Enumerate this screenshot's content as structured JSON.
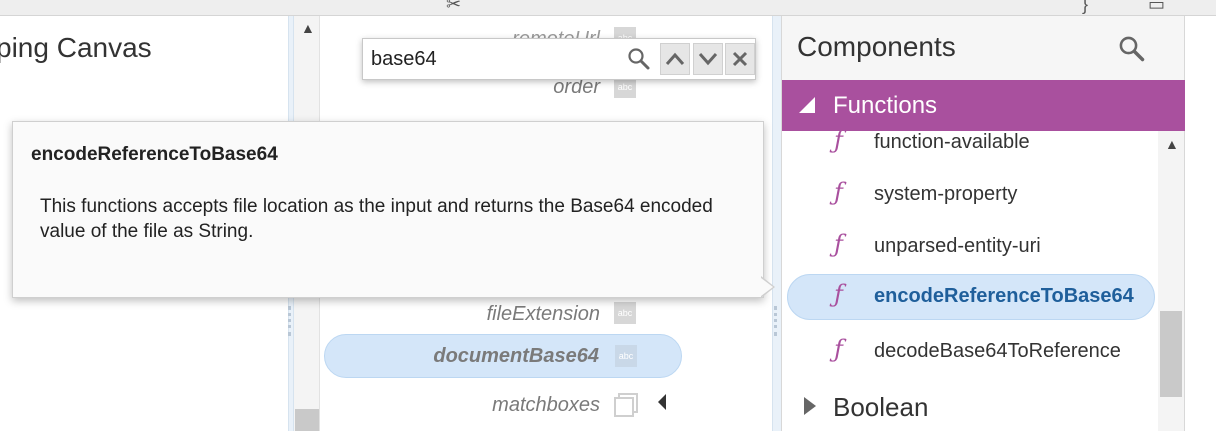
{
  "canvas": {
    "title": "ping Canvas"
  },
  "search": {
    "value": "base64"
  },
  "source_fields": [
    {
      "name": "remoteUrl",
      "type": "abc"
    },
    {
      "name": "order",
      "type": "abc"
    },
    {
      "name": "fileExtension",
      "type": "abc"
    },
    {
      "name": "documentBase64",
      "type": "abc"
    },
    {
      "name": "matchboxes",
      "type": ""
    }
  ],
  "tooltip": {
    "title": "encodeReferenceToBase64",
    "body": "This functions accepts file location as the input and returns the Base64 encoded value of the file as String."
  },
  "components": {
    "title": "Components",
    "categories": [
      {
        "label": "Functions",
        "expanded": true,
        "color": "#a9509e",
        "items": [
          {
            "glyph": "ƒ",
            "label": "function-available"
          },
          {
            "glyph": "ƒ",
            "label": "system-property"
          },
          {
            "glyph": "ƒ",
            "label": "unparsed-entity-uri"
          },
          {
            "glyph": "ƒ",
            "label": "encodeReferenceToBase64",
            "selected": true
          },
          {
            "glyph": "ƒ",
            "label": "decodeBase64ToReference"
          }
        ]
      },
      {
        "label": "Boolean",
        "expanded": false
      }
    ]
  },
  "colors": {
    "accent": "#a9509e",
    "selection": "#d4e6f9",
    "selected_text": "#1f5f9b"
  }
}
